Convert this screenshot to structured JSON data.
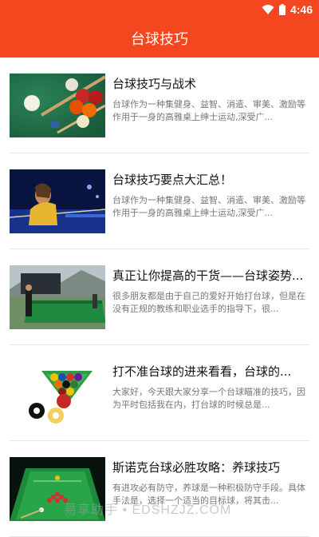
{
  "status_bar": {
    "time": "4:46",
    "icons": [
      "wifi-icon",
      "battery-icon"
    ]
  },
  "app_bar": {
    "title": "台球技巧"
  },
  "articles": [
    {
      "title": "台球技巧与战术",
      "summary": "台球作为一种集健身、益智、消遣、审美、激励等作用于一身的高雅桌上绅士运动,深受广...",
      "image": "billiard-balls-image"
    },
    {
      "title": "台球技巧要点大汇总！",
      "summary": "台球作为一种集健身、益智、消遣、审美、激励等作用于一身的高雅桌上绅士运动,深受广...",
      "image": "player-cue-image"
    },
    {
      "title": "真正让你提高的干货——台球姿势...",
      "summary": "很多朋友都是由于自己的爱好开始打台球，但是在没有正规的教练和职业选手的指导下，很...",
      "image": "outdoor-table-image"
    },
    {
      "title": "打不准台球的进来看看，台球的...",
      "summary": "大家好，今天跟大家分享一个台球瞄准的技巧，因为平时包括我在内，打台球的时候总是...",
      "image": "racked-balls-image"
    },
    {
      "title": "斯诺克台球必胜攻略：养球技巧",
      "summary": "有进攻必有防守，养球是一种积极防守手段。具体手法是，选择一个适当的目标球，将其击...",
      "image": "snooker-table-image"
    }
  ],
  "watermark": "易享助手 • EDSHZJZ.COM"
}
